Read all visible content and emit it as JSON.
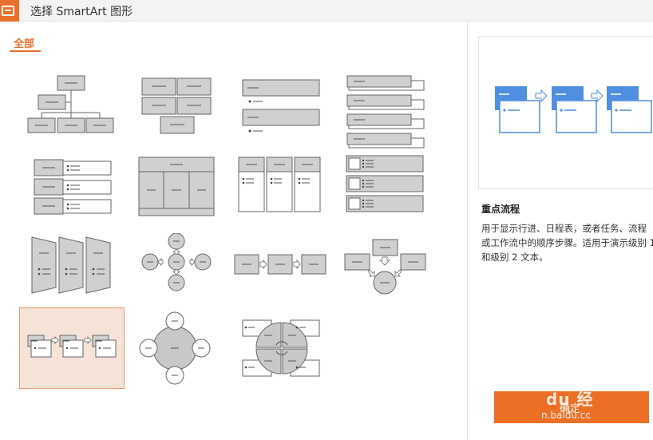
{
  "window": {
    "title": "选择 SmartArt 图形",
    "app_icon": "wps-icon",
    "accent_color": "#e8712d"
  },
  "categories": [
    {
      "label": "全部",
      "active": true
    }
  ],
  "gallery": {
    "items": [
      {
        "name": "org-chart",
        "selected": false
      },
      {
        "name": "block-list",
        "selected": false
      },
      {
        "name": "stacked-bullet-list",
        "selected": false
      },
      {
        "name": "layered-bullet-list",
        "selected": false
      },
      {
        "name": "horizontal-bullet-list",
        "selected": false
      },
      {
        "name": "table-hierarchy",
        "selected": false
      },
      {
        "name": "column-list",
        "selected": false
      },
      {
        "name": "picture-bullet-list",
        "selected": false
      },
      {
        "name": "chevron-panels",
        "selected": false
      },
      {
        "name": "radial-arrows",
        "selected": false
      },
      {
        "name": "basic-process",
        "selected": false
      },
      {
        "name": "converging-process",
        "selected": false
      },
      {
        "name": "accent-process",
        "selected": true
      },
      {
        "name": "radial-circle",
        "selected": false
      },
      {
        "name": "cycle-matrix",
        "selected": false
      }
    ]
  },
  "preview": {
    "title": "重点流程",
    "description": "用于显示行进、日程表，或者任务、流程或工作流中的顺序步骤。适用于演示级别 1 和级别 2 文本。"
  },
  "buttons": {
    "ok": "确定"
  },
  "watermark": {
    "logo": "du 经",
    "url": "n.baidu.cc"
  }
}
